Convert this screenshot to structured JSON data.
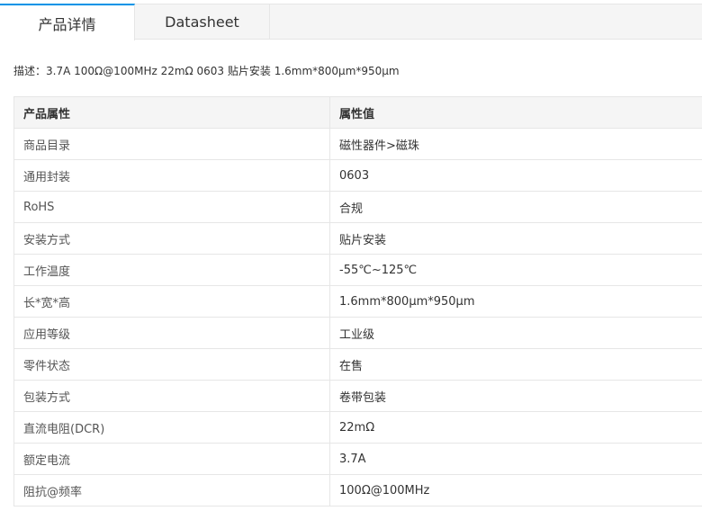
{
  "tabs": [
    {
      "label": "产品详情",
      "active": true
    },
    {
      "label": "Datasheet",
      "active": false
    }
  ],
  "description": "描述：3.7A 100Ω@100MHz 22mΩ 0603 贴片安装 1.6mm*800µm*950µm",
  "table": {
    "headers": [
      "产品属性",
      "属性值"
    ],
    "rows": [
      {
        "name": "商品目录",
        "value": "磁性器件>磁珠"
      },
      {
        "name": "通用封装",
        "value": "0603"
      },
      {
        "name": "RoHS",
        "value": "合规"
      },
      {
        "name": "安装方式",
        "value": "贴片安装"
      },
      {
        "name": "工作温度",
        "value": "-55℃~125℃"
      },
      {
        "name": "长*宽*高",
        "value": "1.6mm*800µm*950µm"
      },
      {
        "name": "应用等级",
        "value": "工业级"
      },
      {
        "name": "零件状态",
        "value": "在售"
      },
      {
        "name": "包装方式",
        "value": "卷带包装"
      },
      {
        "name": "直流电阻(DCR)",
        "value": "22mΩ"
      },
      {
        "name": "额定电流",
        "value": "3.7A"
      },
      {
        "name": "阻抗@频率",
        "value": "100Ω@100MHz"
      }
    ]
  },
  "colors": {
    "accent": "#0093e6",
    "border": "#e6e6e6",
    "header_bg": "#f5f5f5"
  }
}
